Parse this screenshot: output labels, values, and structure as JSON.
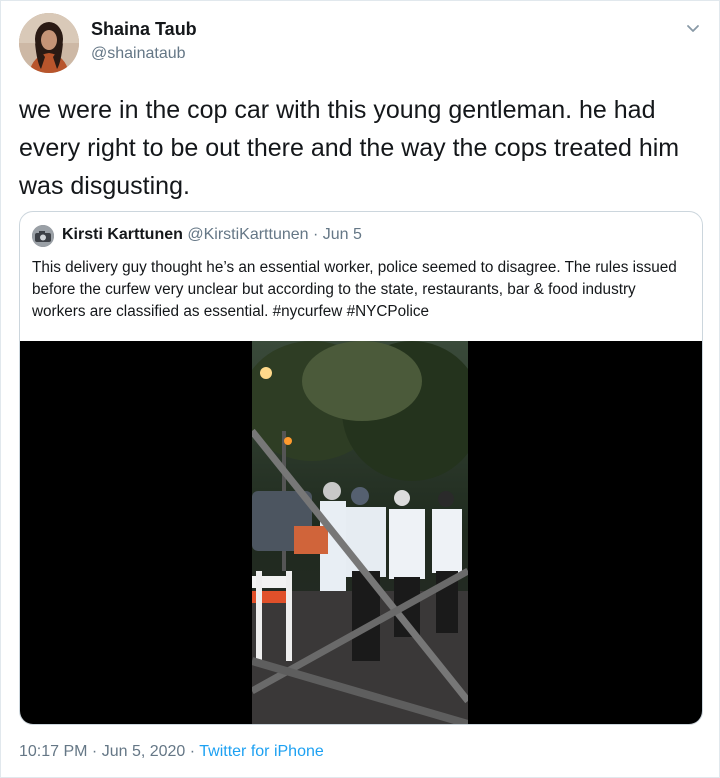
{
  "author": {
    "name": "Shaina Taub",
    "handle": "@shainataub",
    "avatar_icon": "profile-photo"
  },
  "menu_icon": "chevron-down-icon",
  "tweet": {
    "text": "we were in the cop car with this young gentleman. he had every right to be out there and the way the cops treated him was disgusting."
  },
  "quoted_tweet": {
    "name": "Kirsti Karttunen",
    "handle": "@KirstiKarttunen",
    "separator": "·",
    "date": "Jun 5",
    "text": "This delivery guy thought he’s an essential worker, police seemed to disagree. The rules issued before the curfew very unclear but according to the state, restaurants, bar & food industry workers are classified as essential. #nycurfew #NYCPolice",
    "media": "video-thumbnail"
  },
  "meta": {
    "time": "10:17 PM",
    "separator1": " · ",
    "date": "Jun 5, 2020",
    "separator2": " · ",
    "source": "Twitter for iPhone"
  },
  "colors": {
    "link": "#1da1f2",
    "secondary": "#657786",
    "border": "#ccd6dd"
  }
}
